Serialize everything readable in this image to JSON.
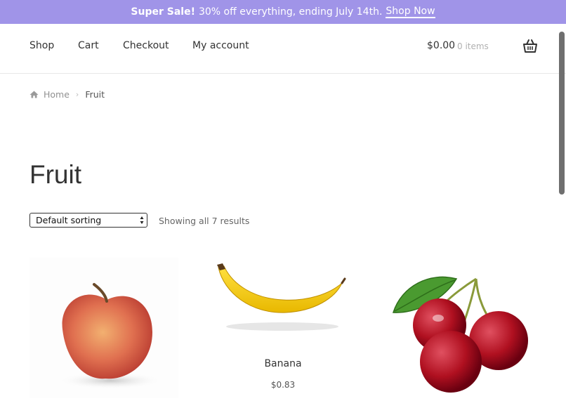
{
  "banner": {
    "bold_text": "Super Sale!",
    "text": "30% off everything, ending July 14th.",
    "link_label": "Shop Now"
  },
  "nav": {
    "items": [
      {
        "label": "Shop"
      },
      {
        "label": "Cart"
      },
      {
        "label": "Checkout"
      },
      {
        "label": "My account"
      }
    ],
    "cart_total": "$0.00",
    "cart_count": "0 items"
  },
  "breadcrumb": {
    "home": "Home",
    "current": "Fruit"
  },
  "page_title": "Fruit",
  "sorting": {
    "selected": "Default sorting"
  },
  "results_text": "Showing all 7 results",
  "products": [
    {
      "name": "",
      "price": "",
      "image": "apple-image"
    },
    {
      "name": "Banana",
      "price": "$0.83",
      "image": "banana-image"
    },
    {
      "name": "",
      "price": "",
      "image": "cherries-image"
    }
  ],
  "colors": {
    "banner_bg": "#a094e8",
    "text": "#333333"
  }
}
